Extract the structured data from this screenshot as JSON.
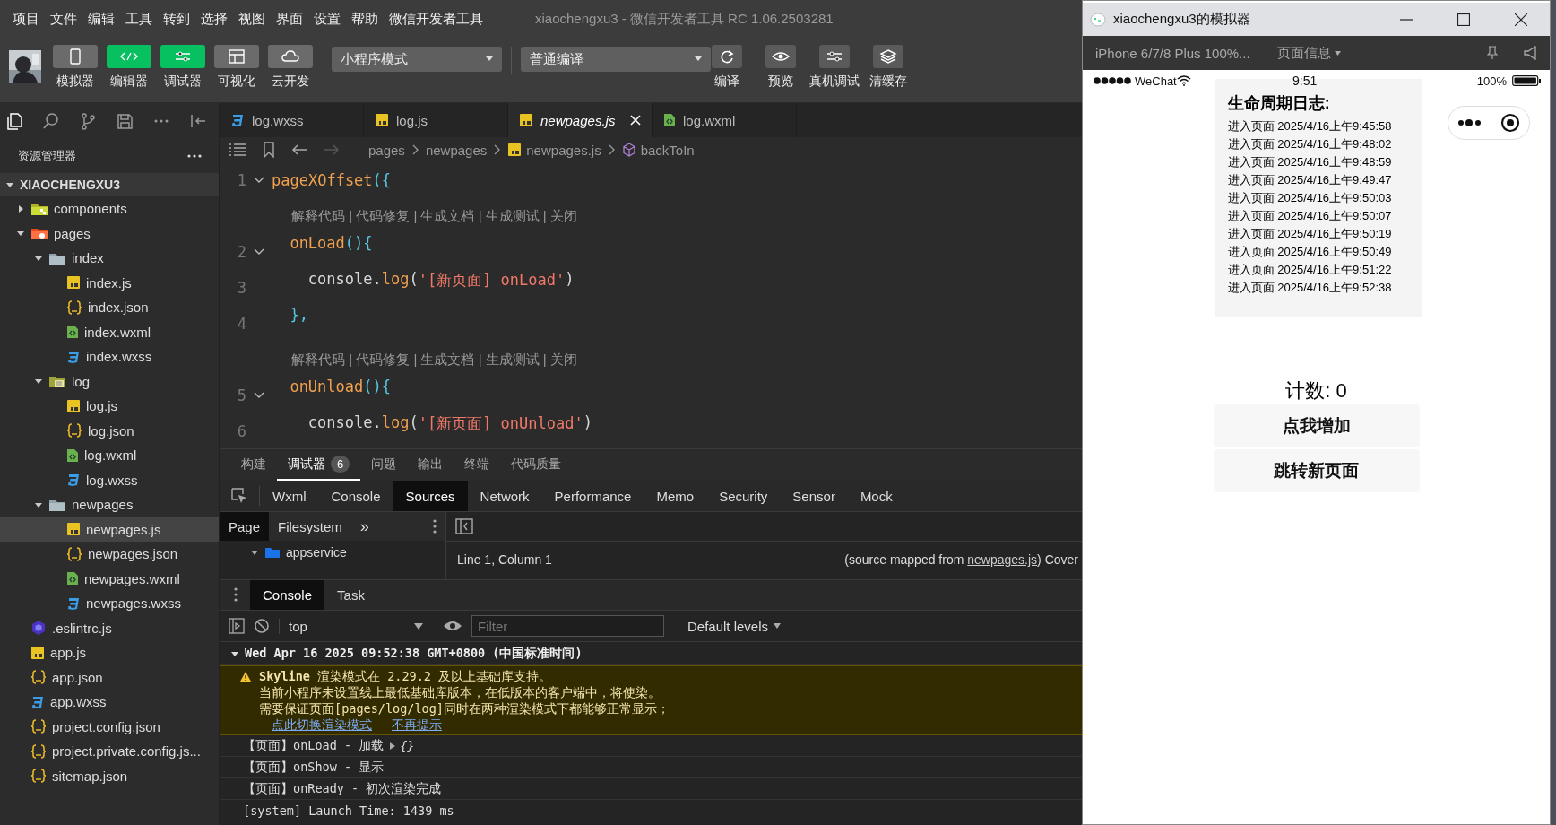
{
  "menu_bar": {
    "items": [
      "项目",
      "文件",
      "编辑",
      "工具",
      "转到",
      "选择",
      "视图",
      "界面",
      "设置",
      "帮助",
      "微信开发者工具"
    ],
    "title": "xiaochengxu3 - 微信开发者工具 RC 1.06.2503281"
  },
  "toolbar": {
    "tools": [
      {
        "label": "模拟器",
        "kind": "phone",
        "selected": false
      },
      {
        "label": "编辑器",
        "kind": "code",
        "selected": true
      },
      {
        "label": "调试器",
        "kind": "debug",
        "selected": true
      },
      {
        "label": "可视化",
        "kind": "layout",
        "selected": false
      },
      {
        "label": "云开发",
        "kind": "cloud",
        "selected": false
      }
    ],
    "mode": "小程序模式",
    "compile_mode": "普通编译",
    "actions": [
      {
        "label": "编译",
        "kind": "refresh"
      },
      {
        "label": "预览",
        "kind": "eye"
      },
      {
        "label": "真机调试",
        "kind": "debug"
      },
      {
        "label": "清缓存",
        "kind": "layers"
      }
    ]
  },
  "explorer": {
    "title": "资源管理器",
    "project": "XIAOCHENGXU3",
    "tree": [
      {
        "name": "components",
        "kind": "folder-components",
        "expanded": false,
        "selected": false
      },
      {
        "name": "pages",
        "kind": "folder-pages",
        "expanded": true,
        "selected": false,
        "children": [
          {
            "name": "index",
            "kind": "folder",
            "expanded": true,
            "selected": false,
            "children": [
              {
                "name": "index.js",
                "kind": "js",
                "selected": false
              },
              {
                "name": "index.json",
                "kind": "json",
                "selected": false
              },
              {
                "name": "index.wxml",
                "kind": "wxml",
                "selected": false
              },
              {
                "name": "index.wxss",
                "kind": "wxss",
                "selected": false
              }
            ]
          },
          {
            "name": "log",
            "kind": "folder-doc",
            "expanded": true,
            "selected": false,
            "children": [
              {
                "name": "log.js",
                "kind": "js",
                "selected": false
              },
              {
                "name": "log.json",
                "kind": "json",
                "selected": false
              },
              {
                "name": "log.wxml",
                "kind": "wxml",
                "selected": false
              },
              {
                "name": "log.wxss",
                "kind": "wxss",
                "selected": false
              }
            ]
          },
          {
            "name": "newpages",
            "kind": "folder",
            "expanded": true,
            "selected": false,
            "children": [
              {
                "name": "newpages.js",
                "kind": "js",
                "selected": true
              },
              {
                "name": "newpages.json",
                "kind": "json",
                "selected": false
              },
              {
                "name": "newpages.wxml",
                "kind": "wxml",
                "selected": false
              },
              {
                "name": "newpages.wxss",
                "kind": "wxss",
                "selected": false
              }
            ]
          }
        ]
      },
      {
        "name": ".eslintrc.js",
        "kind": "eslint",
        "selected": false
      },
      {
        "name": "app.js",
        "kind": "js",
        "selected": false
      },
      {
        "name": "app.json",
        "kind": "json",
        "selected": false
      },
      {
        "name": "app.wxss",
        "kind": "wxss",
        "selected": false
      },
      {
        "name": "project.config.json",
        "kind": "json",
        "selected": false
      },
      {
        "name": "project.private.config.js...",
        "kind": "json",
        "selected": false
      },
      {
        "name": "sitemap.json",
        "kind": "json",
        "selected": false
      }
    ]
  },
  "editor": {
    "tabs": [
      {
        "label": "log.wxss",
        "kind": "wxss",
        "selected": false
      },
      {
        "label": "log.js",
        "kind": "js",
        "selected": false
      },
      {
        "label": "newpages.js",
        "kind": "js",
        "selected": true
      },
      {
        "label": "log.wxml",
        "kind": "wxml",
        "selected": false
      }
    ],
    "breadcrumb": [
      {
        "label": "pages",
        "kind": "folder"
      },
      {
        "label": "newpages",
        "kind": "folder"
      },
      {
        "label": "newpages.js",
        "kind": "js"
      },
      {
        "label": "backToIn",
        "kind": "method"
      }
    ],
    "lines": [
      {
        "kind": "code",
        "number": "1",
        "foldable": true,
        "tokens": [
          {
            "text": "pageXOffset",
            "kind": "fn"
          },
          {
            "text": "({",
            "kind": "punct"
          }
        ]
      },
      {
        "kind": "lens",
        "text": "解释代码 | 代码修复 | 生成文档 | 生成测试 | 关闭"
      },
      {
        "kind": "code",
        "number": "2",
        "foldable": true,
        "tokens": [
          {
            "text": "  onLoad",
            "kind": "fn"
          },
          {
            "text": "(){",
            "kind": "punct"
          }
        ]
      },
      {
        "kind": "code",
        "number": "3",
        "foldable": false,
        "tokens": [
          {
            "text": "    console.",
            "kind": "plain"
          },
          {
            "text": "log",
            "kind": "fn"
          },
          {
            "text": "(",
            "kind": "plain"
          },
          {
            "text": "'[新页面] onLoad'",
            "kind": "string"
          },
          {
            "text": ")",
            "kind": "plain"
          }
        ]
      },
      {
        "kind": "code",
        "number": "4",
        "foldable": false,
        "tokens": [
          {
            "text": "  },",
            "kind": "punct"
          }
        ]
      },
      {
        "kind": "lens",
        "text": "解释代码 | 代码修复 | 生成文档 | 生成测试 | 关闭"
      },
      {
        "kind": "code",
        "number": "5",
        "foldable": true,
        "tokens": [
          {
            "text": "  onUnload",
            "kind": "fn"
          },
          {
            "text": "(){",
            "kind": "punct"
          }
        ]
      },
      {
        "kind": "code",
        "number": "6",
        "foldable": false,
        "tokens": [
          {
            "text": "    console.",
            "kind": "plain"
          },
          {
            "text": "log",
            "kind": "fn"
          },
          {
            "text": "(",
            "kind": "plain"
          },
          {
            "text": "'[新页面] onUnload'",
            "kind": "string"
          },
          {
            "text": ")",
            "kind": "plain"
          }
        ]
      }
    ]
  },
  "panel": {
    "tabs": [
      {
        "label": "构建",
        "selected": false
      },
      {
        "label": "调试器",
        "badge": "6",
        "selected": true
      },
      {
        "label": "问题",
        "selected": false
      },
      {
        "label": "输出",
        "selected": false
      },
      {
        "label": "终端",
        "selected": false
      },
      {
        "label": "代码质量",
        "selected": false
      }
    ],
    "devtools_tabs": [
      {
        "label": "Wxml",
        "selected": false
      },
      {
        "label": "Console",
        "selected": false
      },
      {
        "label": "Sources",
        "selected": true
      },
      {
        "label": "Network",
        "selected": false
      },
      {
        "label": "Performance",
        "selected": false
      },
      {
        "label": "Memo",
        "selected": false
      },
      {
        "label": "Security",
        "selected": false
      },
      {
        "label": "Sensor",
        "selected": false
      },
      {
        "label": "Mock",
        "selected": false
      }
    ],
    "sources": {
      "tabs": [
        {
          "label": "Page",
          "selected": true
        },
        {
          "label": "Filesystem",
          "selected": false
        }
      ],
      "more": "»",
      "tree": [
        {
          "name": "appservice",
          "expanded": true
        }
      ],
      "status": "Line 1, Column 1",
      "mapped_prefix": "(source mapped from ",
      "mapped_link": "newpages.js",
      "mapped_suffix": ") Cover"
    },
    "console": {
      "tabs": [
        {
          "label": "Console",
          "selected": true
        },
        {
          "label": "Task",
          "selected": false
        }
      ],
      "context": "top",
      "filter_placeholder": "Filter",
      "levels": "Default levels",
      "entries": [
        {
          "kind": "group",
          "text": "Wed Apr 16 2025 09:52:38 GMT+0800 (中国标准时间)",
          "expanded": true
        },
        {
          "kind": "warning",
          "lines": [
            "**Skyline** 渲染模式在 2.29.2 及以上基础库支持。",
            "当前小程序未设置线上最低基础库版本，在低版本的客户端中，将使染。",
            "需要保证页面[pages/log/log]同时在两种渲染模式下都能够正常显示；"
          ],
          "links": [
            "点此切换渲染模式",
            "不再提示"
          ]
        },
        {
          "kind": "log",
          "text": "【页面】onLoad - 加载",
          "object": "{}"
        },
        {
          "kind": "log",
          "text": "【页面】onShow - 显示"
        },
        {
          "kind": "log",
          "text": "【页面】onReady - 初次渲染完成"
        },
        {
          "kind": "log",
          "text": "[system] Launch Time: 1439 ms"
        }
      ]
    }
  },
  "simulator": {
    "title": "xiaochengxu3的模拟器",
    "device": "iPhone 6/7/8 Plus 100%...",
    "page_info": "页面信息",
    "status_bar": {
      "carrier": "WeChat",
      "time": "9:51",
      "battery": "100%"
    },
    "log_card": {
      "title": "生命周期日志:",
      "entries": [
        "进入页面 2025/4/16上午9:45:58",
        "进入页面 2025/4/16上午9:48:02",
        "进入页面 2025/4/16上午9:48:59",
        "进入页面 2025/4/16上午9:49:47",
        "进入页面 2025/4/16上午9:50:03",
        "进入页面 2025/4/16上午9:50:07",
        "进入页面 2025/4/16上午9:50:19",
        "进入页面 2025/4/16上午9:50:49",
        "进入页面 2025/4/16上午9:51:22",
        "进入页面 2025/4/16上午9:52:38"
      ]
    },
    "count": "计数: 0",
    "buttons": [
      "点我增加",
      "跳转新页面"
    ]
  }
}
